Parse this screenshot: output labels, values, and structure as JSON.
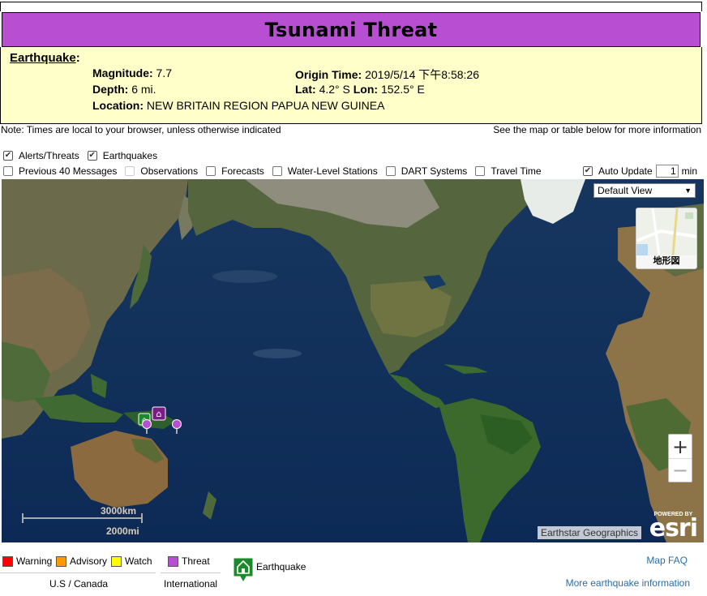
{
  "banner": {
    "title": "Tsunami Threat",
    "color": "#b84fd2"
  },
  "earthquake": {
    "heading": "Earthquake",
    "colon": ":",
    "magnitude_label": "Magnitude:",
    "magnitude_value": "7.7",
    "depth_label": "Depth:",
    "depth_value": "6 mi.",
    "location_label": "Location:",
    "location_value": "NEW BRITAIN REGION PAPUA NEW GUINEA",
    "origin_label": "Origin Time:",
    "origin_value": "2019/5/14 下午8:58:26",
    "lat_label": "Lat:",
    "lat_value": "4.2° S",
    "lon_label": "Lon:",
    "lon_value": "152.5° E"
  },
  "notes": {
    "left": "Note: Times are local to your browser, unless otherwise indicated",
    "right": "See the map or table below for more information"
  },
  "layers_row1": [
    {
      "label": "Alerts/Threats",
      "checked": true
    },
    {
      "label": "Earthquakes",
      "checked": true
    }
  ],
  "layers_row2": [
    {
      "label": "Previous 40 Messages",
      "checked": false
    },
    {
      "label": "Observations",
      "checked": false
    },
    {
      "label": "Forecasts",
      "checked": false
    },
    {
      "label": "Water-Level Stations",
      "checked": false
    },
    {
      "label": "DART Systems",
      "checked": false
    },
    {
      "label": "Travel Time",
      "checked": false
    }
  ],
  "auto_update": {
    "label": "Auto Update",
    "checked": true,
    "value": "1",
    "unit": "min"
  },
  "map": {
    "view_select": "Default View",
    "basemap_label": "地形図",
    "zoom_in": "+",
    "zoom_out": "−",
    "scale_km": "3000km",
    "scale_mi": "2000mi",
    "attribution": "Earthstar Geographics",
    "esri_powered": "POWERED BY",
    "esri_word": "esri"
  },
  "legend": {
    "warning": {
      "label": "Warning",
      "color": "#ff0000"
    },
    "advisory": {
      "label": "Advisory",
      "color": "#ff9900"
    },
    "watch": {
      "label": "Watch",
      "color": "#ffff00"
    },
    "threat": {
      "label": "Threat",
      "color": "#b84fd2"
    },
    "us_canada": "U.S / Canada",
    "international": "International",
    "earthquake": "Earthquake",
    "map_faq": "Map FAQ",
    "more_info": "More earthquake information"
  }
}
